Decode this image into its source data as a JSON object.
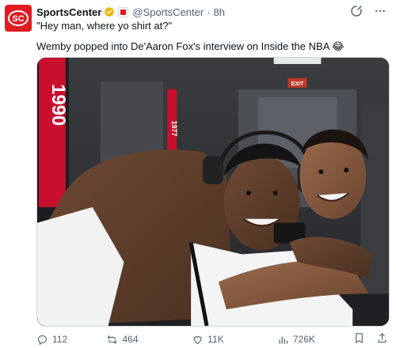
{
  "account": {
    "name": "SportsCenter",
    "handle": "@SportsCenter",
    "separator": "·",
    "time": "8h",
    "avatar_text": "SC",
    "brand_color": "#e01b22"
  },
  "tweet": {
    "line1": "\"Hey man, where yo shirt at?\"",
    "line2": "Wemby popped into De'Aaron Fox's interview on Inside the NBA 😂"
  },
  "media": {
    "banner_text": "1990",
    "banner_text_2": "1977",
    "exit_sign": "EXIT"
  },
  "stats": {
    "replies": "112",
    "reposts": "464",
    "likes": "11K",
    "views": "726K"
  },
  "colors": {
    "text": "#0f1419",
    "muted": "#536471",
    "verified": "#f4b400",
    "accent_red": "#e01b22"
  }
}
